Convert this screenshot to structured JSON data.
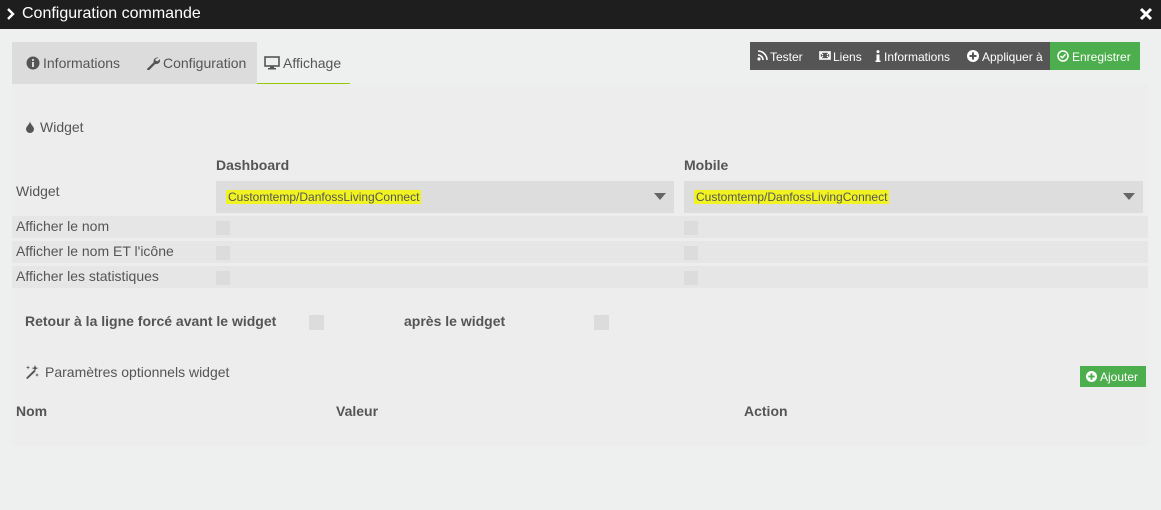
{
  "window": {
    "title": "Configuration commande"
  },
  "tabs": [
    {
      "label": "Informations",
      "icon": "info-circle-icon"
    },
    {
      "label": "Configuration",
      "icon": "wrench-icon"
    },
    {
      "label": "Affichage",
      "icon": "desktop-icon",
      "active": true
    }
  ],
  "actions": {
    "tester": "Tester",
    "liens": "Liens",
    "informations": "Informations",
    "appliquer": "Appliquer à",
    "enregistrer": "Enregistrer"
  },
  "widget_section": {
    "title": "Widget",
    "columns": {
      "dashboard": "Dashboard",
      "mobile": "Mobile"
    },
    "widget_row_label": "Widget",
    "dashboard_value": "Customtemp/DanfossLivingConnect",
    "mobile_value": "Customtemp/DanfossLivingConnect",
    "rows": [
      {
        "label": "Afficher le nom"
      },
      {
        "label": "Afficher le nom ET l'icône"
      },
      {
        "label": "Afficher les statistiques"
      }
    ]
  },
  "line_break": {
    "before_label": "Retour à la ligne forcé avant le widget",
    "after_label": "après le widget"
  },
  "optional_params": {
    "title": "Paramètres optionnels widget",
    "add_label": "Ajouter",
    "headers": {
      "name": "Nom",
      "value": "Valeur",
      "action": "Action"
    }
  },
  "colors": {
    "accent_green": "#4cae4c",
    "tab_underline": "#94ca02",
    "highlight": "#f0f321",
    "titlebar": "#1e1e1e",
    "button_dark": "#555555"
  }
}
